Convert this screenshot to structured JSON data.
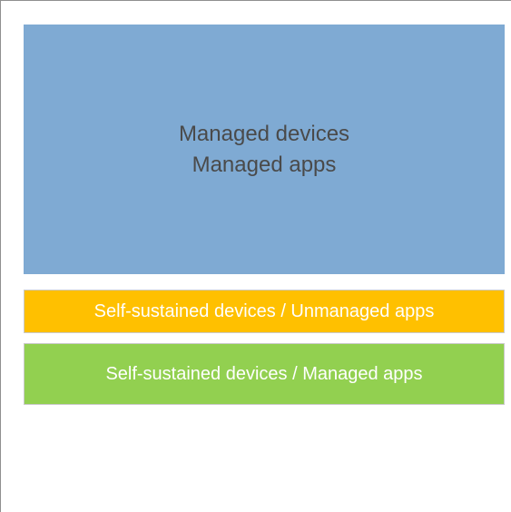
{
  "diagram": {
    "managed_block": {
      "line1": "Managed devices",
      "line2": "Managed apps",
      "color": "#7faad3"
    },
    "unmanaged_block": {
      "label": "Self-sustained devices / Unmanaged apps",
      "color": "#ffc000"
    },
    "self_managed_block": {
      "label": "Self-sustained devices / Managed apps",
      "color": "#92d050"
    }
  }
}
